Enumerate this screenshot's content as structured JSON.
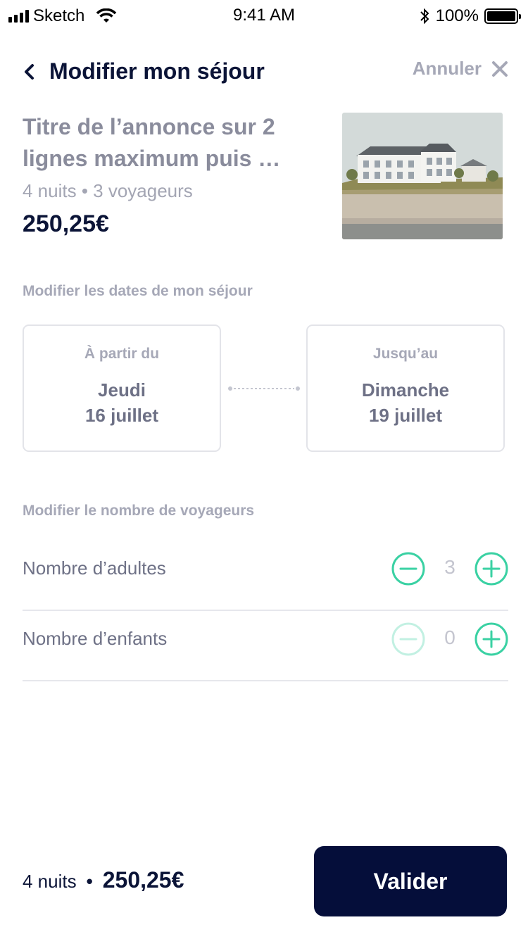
{
  "status_bar": {
    "carrier": "Sketch",
    "time": "9:41 AM",
    "battery": "100%",
    "battery_level": 1.0
  },
  "header": {
    "title": "Modifier mon séjour",
    "cancel_label": "Annuler"
  },
  "listing": {
    "title": "Titre de l’annonce sur 2 lignes maximum puis …",
    "meta": "4 nuits • 3 voyageurs",
    "price": "250,25€"
  },
  "dates_section": {
    "label": "Modifier les dates de mon séjour",
    "start": {
      "caption": "À partir du",
      "day": "Jeudi",
      "date": "16 juillet"
    },
    "end": {
      "caption": "Jusqu’au",
      "day": "Dimanche",
      "date": "19 juillet"
    }
  },
  "travelers_section": {
    "label": "Modifier le nombre de voyageurs",
    "rows": [
      {
        "label": "Nombre d’adultes",
        "value": "3",
        "minus_disabled": false
      },
      {
        "label": "Nombre d’enfants",
        "value": "0",
        "minus_disabled": true
      }
    ]
  },
  "footer": {
    "nights": "4 nuits",
    "separator": "•",
    "price": "250,25€",
    "validate_label": "Valider"
  },
  "colors": {
    "primary": "#0b1437",
    "accent": "#3ad1a3",
    "muted": "#a6a8b7",
    "button": "#050e3a"
  }
}
